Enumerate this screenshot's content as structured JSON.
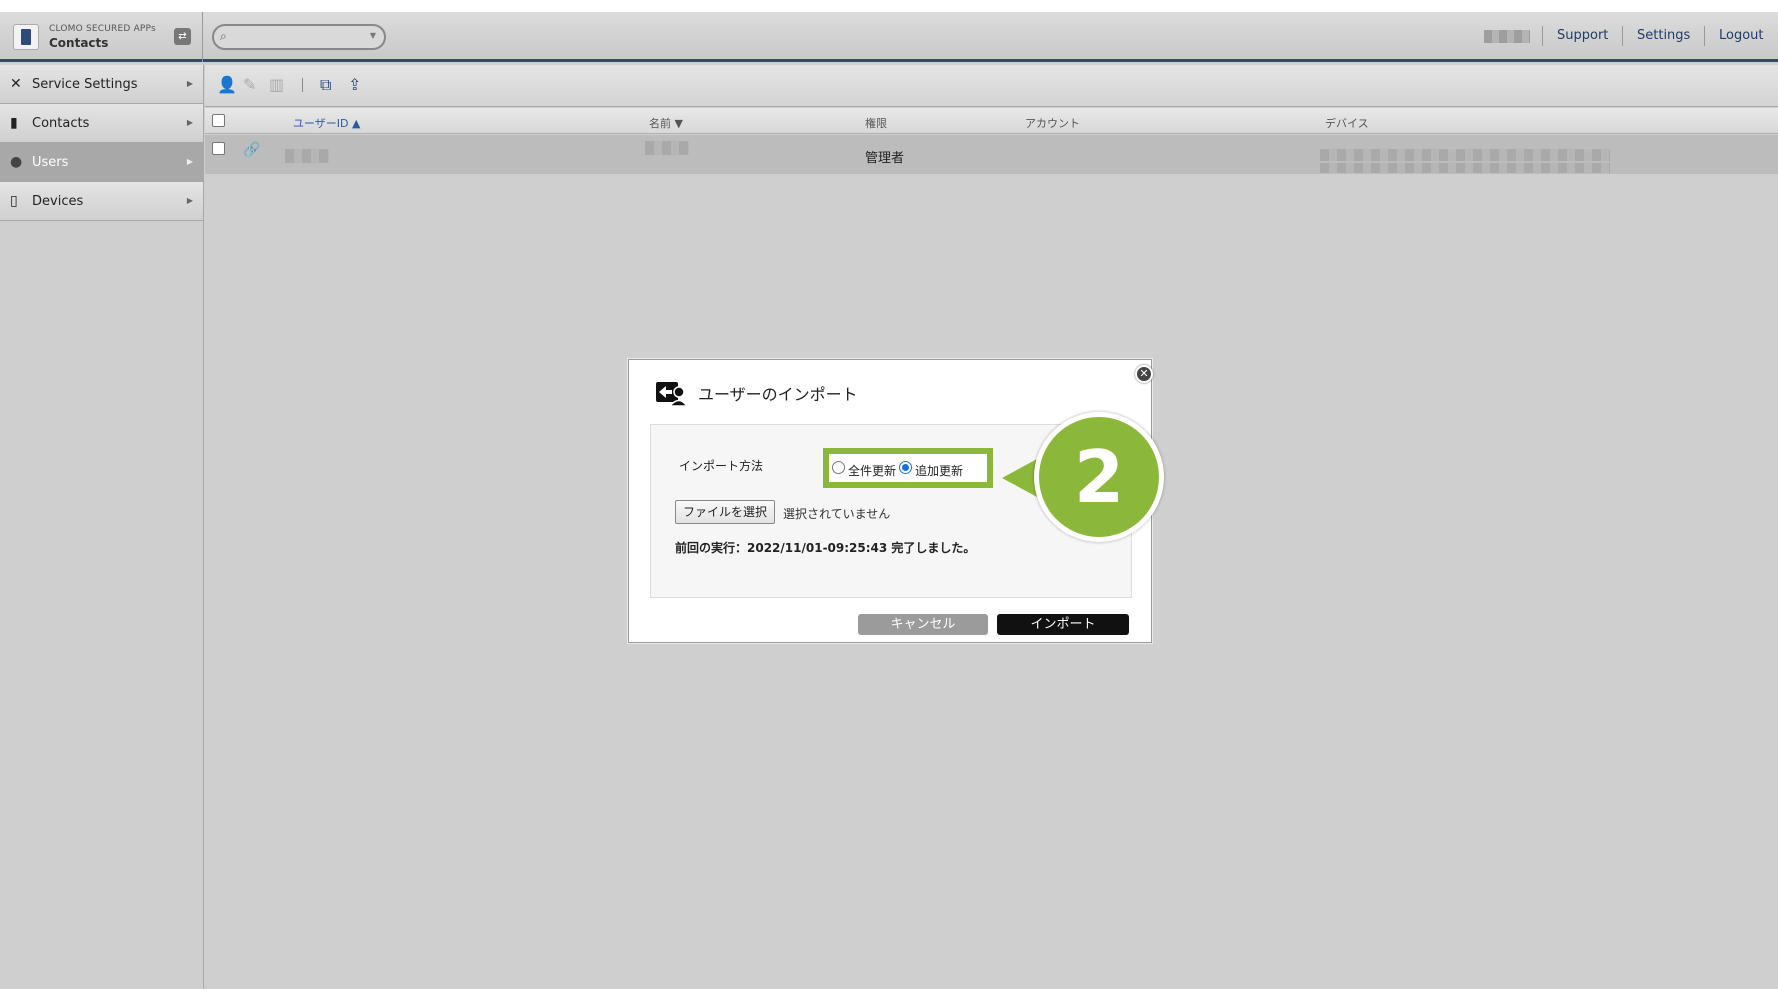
{
  "header": {
    "brand_small": "CLOMO SECURED APPs",
    "brand_name": "Contacts",
    "links": [
      "Support",
      "Settings",
      "Logout"
    ]
  },
  "sidebar": {
    "items": [
      {
        "label": "Service Settings",
        "icon": "tools-icon"
      },
      {
        "label": "Contacts",
        "icon": "contacts-book-icon"
      },
      {
        "label": "Users",
        "icon": "user-icon",
        "active": true
      },
      {
        "label": "Devices",
        "icon": "devices-icon"
      }
    ]
  },
  "table": {
    "columns": [
      "ユーザーID",
      "名前",
      "権限",
      "アカウント",
      "デバイス"
    ],
    "rows": [
      {
        "role": "管理者"
      }
    ]
  },
  "dialog": {
    "title": "ユーザーのインポート",
    "method_label": "インポート方法",
    "options": [
      "全件更新",
      "追加更新"
    ],
    "selected_option": "追加更新",
    "file_button": "ファイルを選択",
    "file_status": "選択されていません",
    "last_run": "前回の実行：2022/11/01-09:25:43 完了しました。",
    "cancel": "キャンセル",
    "import": "インポート"
  },
  "callout": {
    "number": "2",
    "color": "#8bb83a"
  },
  "colors": {
    "accent_navy": "#2e4a6e",
    "link": "#1e3d6b",
    "highlight_green": "#8bb83a"
  }
}
